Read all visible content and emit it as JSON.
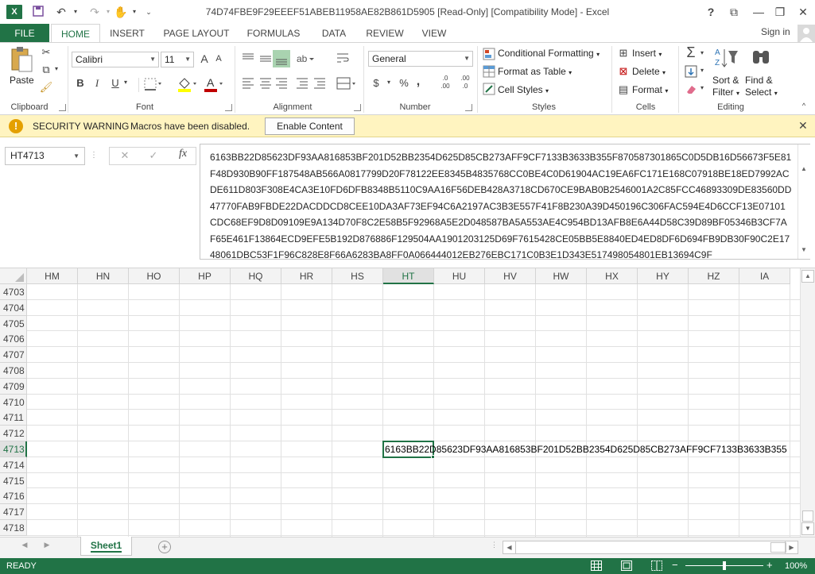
{
  "window": {
    "title": "74D74FBE9F29EEEF51ABEB11958AE82B861D5905  [Read-Only]  [Compatibility Mode] - Excel",
    "app_icon": "X",
    "help": "?",
    "restore_ribbon": "⧉",
    "minimize": "—",
    "maximize": "❐",
    "close": "✕"
  },
  "ribbon_tabs": [
    "FILE",
    "HOME",
    "INSERT",
    "PAGE LAYOUT",
    "FORMULAS",
    "DATA",
    "REVIEW",
    "VIEW"
  ],
  "sign_in": "Sign in",
  "clipboard": {
    "paste": "Paste",
    "group": "Clipboard"
  },
  "font": {
    "name": "Calibri",
    "size": "11",
    "group": "Font",
    "grow": "A",
    "shrink": "A",
    "bold": "B",
    "italic": "I",
    "underline": "U"
  },
  "alignment": {
    "group": "Alignment"
  },
  "number": {
    "format": "General",
    "group": "Number",
    "currency": "$",
    "percent": "%",
    "comma": ",",
    "inc_dec": ".00",
    "dec_dec": ".0"
  },
  "styles": {
    "group": "Styles",
    "conditional": "Conditional Formatting",
    "format_table": "Format as Table",
    "cell_styles": "Cell Styles"
  },
  "cells": {
    "group": "Cells",
    "insert": "Insert",
    "delete": "Delete",
    "format": "Format"
  },
  "editing": {
    "group": "Editing",
    "sort": "Sort &",
    "sort2": "Filter",
    "find": "Find &",
    "find2": "Select"
  },
  "security": {
    "title": "SECURITY WARNING",
    "message": "Macros have been disabled.",
    "button": "Enable Content"
  },
  "formula_bar": {
    "name_box": "HT4713",
    "fx": "fx",
    "content": "6163BB22D85623DF93AA816853BF201D52BB2354D625D85CB273AFF9CF7133B3633B355F870587301865C0D5DB16D56673F5E81F48D930B90FF187548AB566A0817799D20F78122EE8345B4835768CC0BE4C0D61904AC19EA6FC171E168C07918BE18ED7992ACDE611D803F308E4CA3E10FD6DFB8348B5110C9AA16F56DEB428A3718CD670CE9BAB0B2546001A2C85FCC46893309DE83560DD47770FAB9FBDE22DACDDCD8CEE10DA3AF73EF94C6A2197AC3B3E557F41F8B230A39D450196C306FAC594E4D6CCF13E07101CDC68EF9D8D09109E9A134D70F8C2E58B5F92968A5E2D048587BA5A553AE4C954BD13AFB8E6A44D58C39D89BF05346B3CF7AF65E461F13864ECD9EFE5B192D876886F129504AA1901203125D69F7615428CE05BB5E8840ED4ED8DF6D694FB9DB30F90C2E1748061DBC53F1F96C828E8F66A6283BA8FF0A066444012EB276EBC171C0B3E1D343E517498054801EB13694C9F"
  },
  "columns": [
    "HM",
    "HN",
    "HO",
    "HP",
    "HQ",
    "HR",
    "HS",
    "HT",
    "HU",
    "HV",
    "HW",
    "HX",
    "HY",
    "HZ",
    "IA"
  ],
  "selected_column": "HT",
  "rows": [
    "4703",
    "4704",
    "4705",
    "4706",
    "4707",
    "4708",
    "4709",
    "4710",
    "4711",
    "4712",
    "4713",
    "4714",
    "4715",
    "4716",
    "4717",
    "4718"
  ],
  "selected_row": "4713",
  "active_cell_text": "6163BB22D85623DF93AA816853BF201D52BB2354D625D85CB273AFF9CF7133B3633B355",
  "sheet_tab": "Sheet1",
  "status": {
    "ready": "READY",
    "zoom": "100%"
  },
  "colors": {
    "accent": "#217346",
    "security_bg": "#fff4c0"
  }
}
